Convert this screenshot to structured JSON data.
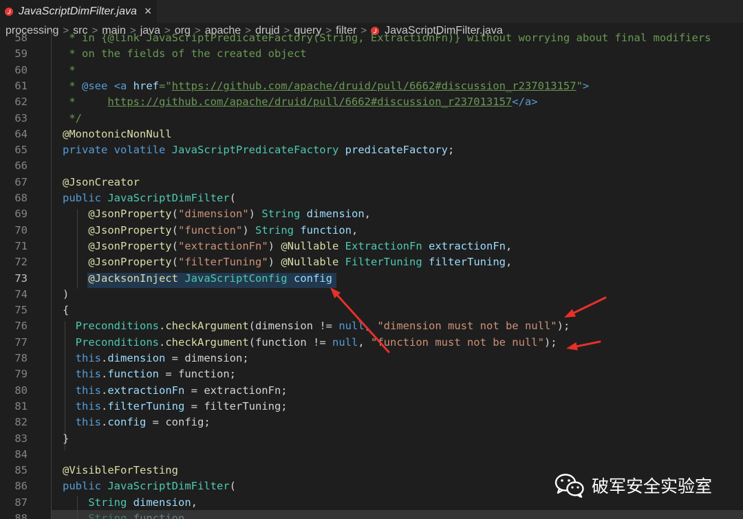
{
  "tab": {
    "title": "JavaScriptDimFilter.java",
    "close": "×",
    "icon": "java-error-file-icon"
  },
  "breadcrumb": {
    "items": [
      "processing",
      "src",
      "main",
      "java",
      "org",
      "apache",
      "druid",
      "query",
      "filter"
    ],
    "separator": ">",
    "file": "JavaScriptDimFilter.java"
  },
  "code": {
    "active_line": 73,
    "lines": [
      {
        "n": 58,
        "tokens": [
          [
            "c-comment",
            " * in {@link JavaScriptPredicateFactory(String, ExtractionFn)} without worrying about final modifiers"
          ]
        ]
      },
      {
        "n": 59,
        "tokens": [
          [
            "c-comment",
            " * on the fields of the created object"
          ]
        ]
      },
      {
        "n": 60,
        "tokens": [
          [
            "c-comment",
            " *"
          ]
        ]
      },
      {
        "n": 61,
        "tokens": [
          [
            "c-comment",
            " * "
          ],
          [
            "c-kw",
            "@see"
          ],
          [
            "c-comment",
            " "
          ],
          [
            "c-tag",
            "<a "
          ],
          [
            "c-tagattr",
            "href"
          ],
          [
            "c-comment",
            "=\""
          ],
          [
            "c-link",
            "https://github.com/apache/druid/pull/6662#discussion_r237013157"
          ],
          [
            "c-comment",
            "\""
          ],
          [
            "c-tag",
            ">"
          ]
        ]
      },
      {
        "n": 62,
        "tokens": [
          [
            "c-comment",
            " *     "
          ],
          [
            "c-link",
            "https://github.com/apache/druid/pull/6662#discussion_r237013157"
          ],
          [
            "c-tag",
            "</a>"
          ]
        ]
      },
      {
        "n": 63,
        "tokens": [
          [
            "c-comment",
            " */"
          ]
        ]
      },
      {
        "n": 64,
        "tokens": [
          [
            "c-annot",
            "@MonotonicNonNull"
          ]
        ]
      },
      {
        "n": 65,
        "tokens": [
          [
            "c-kw",
            "private"
          ],
          [
            "c-text",
            " "
          ],
          [
            "c-kw",
            "volatile"
          ],
          [
            "c-text",
            " "
          ],
          [
            "c-type",
            "JavaScriptPredicateFactory"
          ],
          [
            "c-text",
            " "
          ],
          [
            "c-var",
            "predicateFactory"
          ],
          [
            "c-punc",
            ";"
          ]
        ]
      },
      {
        "n": 66,
        "tokens": [
          [
            "c-text",
            ""
          ]
        ]
      },
      {
        "n": 67,
        "tokens": [
          [
            "c-annot",
            "@JsonCreator"
          ]
        ]
      },
      {
        "n": 68,
        "tokens": [
          [
            "c-kw",
            "public"
          ],
          [
            "c-text",
            " "
          ],
          [
            "c-type",
            "JavaScriptDimFilter"
          ],
          [
            "c-punc",
            "("
          ]
        ]
      },
      {
        "n": 69,
        "tokens": [
          [
            "c-text",
            "    "
          ],
          [
            "c-annot",
            "@JsonProperty"
          ],
          [
            "c-punc",
            "("
          ],
          [
            "c-str",
            "\"dimension\""
          ],
          [
            "c-punc",
            ") "
          ],
          [
            "c-type",
            "String"
          ],
          [
            "c-text",
            " "
          ],
          [
            "c-var",
            "dimension"
          ],
          [
            "c-punc",
            ","
          ]
        ]
      },
      {
        "n": 70,
        "tokens": [
          [
            "c-text",
            "    "
          ],
          [
            "c-annot",
            "@JsonProperty"
          ],
          [
            "c-punc",
            "("
          ],
          [
            "c-str",
            "\"function\""
          ],
          [
            "c-punc",
            ") "
          ],
          [
            "c-type",
            "String"
          ],
          [
            "c-text",
            " "
          ],
          [
            "c-var",
            "function"
          ],
          [
            "c-punc",
            ","
          ]
        ]
      },
      {
        "n": 71,
        "tokens": [
          [
            "c-text",
            "    "
          ],
          [
            "c-annot",
            "@JsonProperty"
          ],
          [
            "c-punc",
            "("
          ],
          [
            "c-str",
            "\"extractionFn\""
          ],
          [
            "c-punc",
            ") "
          ],
          [
            "c-annot",
            "@Nullable"
          ],
          [
            "c-text",
            " "
          ],
          [
            "c-type",
            "ExtractionFn"
          ],
          [
            "c-text",
            " "
          ],
          [
            "c-var",
            "extractionFn"
          ],
          [
            "c-punc",
            ","
          ]
        ]
      },
      {
        "n": 72,
        "tokens": [
          [
            "c-text",
            "    "
          ],
          [
            "c-annot",
            "@JsonProperty"
          ],
          [
            "c-punc",
            "("
          ],
          [
            "c-str",
            "\"filterTuning\""
          ],
          [
            "c-punc",
            ") "
          ],
          [
            "c-annot",
            "@Nullable"
          ],
          [
            "c-text",
            " "
          ],
          [
            "c-type",
            "FilterTuning"
          ],
          [
            "c-text",
            " "
          ],
          [
            "c-var",
            "filterTuning"
          ],
          [
            "c-punc",
            ","
          ]
        ]
      },
      {
        "n": 73,
        "tokens": [
          [
            "c-text",
            "    "
          ],
          [
            "c-annot",
            "@JacksonInject"
          ],
          [
            "c-text",
            " "
          ],
          [
            "c-type",
            "JavaScriptConfig"
          ],
          [
            "c-text",
            " "
          ],
          [
            "c-var",
            "config"
          ]
        ]
      },
      {
        "n": 74,
        "tokens": [
          [
            "c-punc",
            ")"
          ]
        ]
      },
      {
        "n": 75,
        "tokens": [
          [
            "c-punc",
            "{"
          ]
        ]
      },
      {
        "n": 76,
        "tokens": [
          [
            "c-text",
            "  "
          ],
          [
            "c-type",
            "Preconditions"
          ],
          [
            "c-punc",
            "."
          ],
          [
            "c-method",
            "checkArgument"
          ],
          [
            "c-punc",
            "("
          ],
          [
            "c-text",
            "dimension != "
          ],
          [
            "c-kw",
            "null"
          ],
          [
            "c-punc",
            ", "
          ],
          [
            "c-str",
            "\"dimension must not be null\""
          ],
          [
            "c-punc",
            ");"
          ]
        ]
      },
      {
        "n": 77,
        "tokens": [
          [
            "c-text",
            "  "
          ],
          [
            "c-type",
            "Preconditions"
          ],
          [
            "c-punc",
            "."
          ],
          [
            "c-method",
            "checkArgument"
          ],
          [
            "c-punc",
            "("
          ],
          [
            "c-text",
            "function != "
          ],
          [
            "c-kw",
            "null"
          ],
          [
            "c-punc",
            ", "
          ],
          [
            "c-str",
            "\"function must not be null\""
          ],
          [
            "c-punc",
            ");"
          ]
        ]
      },
      {
        "n": 78,
        "tokens": [
          [
            "c-text",
            "  "
          ],
          [
            "c-kw",
            "this"
          ],
          [
            "c-punc",
            "."
          ],
          [
            "c-var",
            "dimension"
          ],
          [
            "c-text",
            " = dimension;"
          ]
        ]
      },
      {
        "n": 79,
        "tokens": [
          [
            "c-text",
            "  "
          ],
          [
            "c-kw",
            "this"
          ],
          [
            "c-punc",
            "."
          ],
          [
            "c-var",
            "function"
          ],
          [
            "c-text",
            " = function;"
          ]
        ]
      },
      {
        "n": 80,
        "tokens": [
          [
            "c-text",
            "  "
          ],
          [
            "c-kw",
            "this"
          ],
          [
            "c-punc",
            "."
          ],
          [
            "c-var",
            "extractionFn"
          ],
          [
            "c-text",
            " = extractionFn;"
          ]
        ]
      },
      {
        "n": 81,
        "tokens": [
          [
            "c-text",
            "  "
          ],
          [
            "c-kw",
            "this"
          ],
          [
            "c-punc",
            "."
          ],
          [
            "c-var",
            "filterTuning"
          ],
          [
            "c-text",
            " = filterTuning;"
          ]
        ]
      },
      {
        "n": 82,
        "tokens": [
          [
            "c-text",
            "  "
          ],
          [
            "c-kw",
            "this"
          ],
          [
            "c-punc",
            "."
          ],
          [
            "c-var",
            "config"
          ],
          [
            "c-text",
            " = config;"
          ]
        ]
      },
      {
        "n": 83,
        "tokens": [
          [
            "c-punc",
            "}"
          ]
        ]
      },
      {
        "n": 84,
        "tokens": [
          [
            "c-text",
            ""
          ]
        ]
      },
      {
        "n": 85,
        "tokens": [
          [
            "c-annot",
            "@VisibleForTesting"
          ]
        ]
      },
      {
        "n": 86,
        "tokens": [
          [
            "c-kw",
            "public"
          ],
          [
            "c-text",
            " "
          ],
          [
            "c-type",
            "JavaScriptDimFilter"
          ],
          [
            "c-punc",
            "("
          ]
        ]
      },
      {
        "n": 87,
        "tokens": [
          [
            "c-text",
            "    "
          ],
          [
            "c-type",
            "String"
          ],
          [
            "c-text",
            " "
          ],
          [
            "c-var",
            "dimension"
          ],
          [
            "c-punc",
            ","
          ]
        ]
      },
      {
        "n": 88,
        "tokens": [
          [
            "c-text",
            "    "
          ],
          [
            "c-type",
            "String"
          ],
          [
            "c-text",
            " "
          ],
          [
            "c-var",
            "function"
          ],
          [
            "c-punc",
            ","
          ]
        ]
      }
    ]
  },
  "annotations": {
    "arrow_color": "#e8302a"
  },
  "watermark": {
    "text": "破军安全实验室",
    "icon": "wechat-icon"
  }
}
